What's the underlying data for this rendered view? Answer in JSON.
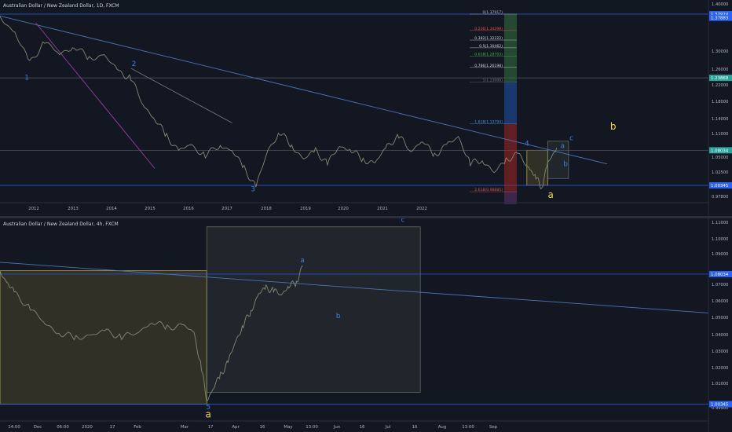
{
  "colors": {
    "background": "#131722",
    "price": "#7f8a72",
    "trendline": "#4a74b8",
    "trend_grey": "#6c7380",
    "trend_purple": "#a03aa8",
    "wave_blue": "#3d7fdc",
    "wave_yellow": "#f5d94a",
    "price_label_blue": "#2962ff",
    "price_label_green": "#26a69a",
    "fib_red": "#b2281f",
    "fib_green": "#2e6a3c",
    "fib_blue": "#1f4f9c",
    "fib_purple": "#5a2e6e"
  },
  "chart_data": [
    {
      "type": "line",
      "title": "Australian Dollar / New Zealand Dollar, 1D, FXCM",
      "x_ticks": [
        "2012",
        "2013",
        "2014",
        "2015",
        "2016",
        "2017",
        "2018",
        "2019",
        "2020",
        "2021",
        "2022"
      ],
      "x_range": [
        2011.1,
        2023.0
      ],
      "y_ticks": [
        "1.40000",
        "1.30000",
        "1.26000",
        "1.22000",
        "1.18000",
        "1.14000",
        "1.11000",
        "1.05000",
        "1.02500",
        "0.97800"
      ],
      "y_range": [
        0.965,
        1.41
      ],
      "price_labels": [
        {
          "text": "1.37924",
          "price": 1.379,
          "color": "blue"
        },
        {
          "text": "1.37883",
          "price": 1.371,
          "color": "blue"
        },
        {
          "text": "1.23868",
          "price": 1.239,
          "color": "green"
        },
        {
          "text": "1.08034",
          "price": 1.08,
          "color": "green"
        },
        {
          "text": "1.00345",
          "price": 1.003,
          "color": "blue"
        }
      ],
      "series": [
        {
          "x": [
            2011.1,
            2011.35,
            2011.6,
            2011.85,
            2012.1,
            2012.35,
            2012.6,
            2012.85,
            2013.1,
            2013.3,
            2013.5,
            2013.7,
            2013.9,
            2014.1,
            2014.3,
            2014.55,
            2014.8,
            2015.0,
            2015.2,
            2015.4,
            2015.6,
            2015.8,
            2016.0,
            2016.2,
            2016.4,
            2016.6,
            2016.8,
            2017.0,
            2017.2,
            2017.4,
            2017.6,
            2017.8,
            2018.0,
            2018.2,
            2018.4,
            2018.6,
            2018.8,
            2019.0,
            2019.2,
            2019.4,
            2019.6,
            2019.8,
            2020.0,
            2020.1,
            2020.2,
            2020.3,
            2020.45
          ],
          "y": [
            1.37,
            1.34,
            1.27,
            1.32,
            1.29,
            1.31,
            1.28,
            1.29,
            1.25,
            1.24,
            1.18,
            1.15,
            1.11,
            1.08,
            1.09,
            1.07,
            1.09,
            1.08,
            1.04,
            1.0,
            1.08,
            1.12,
            1.09,
            1.06,
            1.08,
            1.05,
            1.09,
            1.08,
            1.06,
            1.05,
            1.09,
            1.11,
            1.08,
            1.1,
            1.07,
            1.09,
            1.11,
            1.05,
            1.06,
            1.03,
            1.06,
            1.07,
            1.04,
            1.02,
            1.0,
            1.05,
            1.085
          ]
        }
      ],
      "trendlines": [
        {
          "from": [
            2011.1,
            1.375
          ],
          "to": [
            2021.3,
            1.05
          ],
          "color": "trendline"
        },
        {
          "from": [
            2013.3,
            1.26
          ],
          "to": [
            2015.0,
            1.14
          ],
          "color": "trend_grey"
        },
        {
          "from": [
            2011.7,
            1.36
          ],
          "to": [
            2013.7,
            1.04
          ],
          "color": "trend_purple"
        }
      ],
      "horizontal_levels": [
        1.379,
        1.239,
        1.08,
        1.003
      ],
      "boxes": [
        {
          "x": [
            2019.95,
            2020.3
          ],
          "y": [
            1.003,
            1.08
          ],
          "color": "wave_yellow"
        },
        {
          "x": [
            2020.3,
            2020.65
          ],
          "y": [
            1.018,
            1.1
          ],
          "color": "price"
        }
      ],
      "fib_levels": [
        {
          "label": "0(1.37917)",
          "price": 1.379,
          "color": "#b2b5be"
        },
        {
          "label": "0.236(1.34298)",
          "price": 1.343,
          "color": "#e05252"
        },
        {
          "label": "0.382(1.32222)",
          "price": 1.322,
          "color": "#d1d4dc"
        },
        {
          "label": "0.5(1.30462)",
          "price": 1.305,
          "color": "#d1d4dc"
        },
        {
          "label": "0.618(1.28703)",
          "price": 1.287,
          "color": "#4caf50"
        },
        {
          "label": "0.786(1.26198)",
          "price": 1.262,
          "color": "#d1d4dc"
        },
        {
          "label": "1(1.23000)",
          "price": 1.23,
          "color": "#6c7380"
        },
        {
          "label": "1.618(1.13794)",
          "price": 1.138,
          "color": "#4a90e2"
        },
        {
          "label": "2.618(0.98885)",
          "price": 0.989,
          "color": "#e05252"
        }
      ],
      "wave_labels": [
        {
          "text": "1",
          "x": 2011.55,
          "y": 1.235,
          "color": "wave_blue"
        },
        {
          "text": "2",
          "x": 2013.35,
          "y": 1.265,
          "color": "wave_blue"
        },
        {
          "text": "3",
          "x": 2015.35,
          "y": 0.99,
          "color": "wave_blue"
        },
        {
          "text": "4",
          "x": 2019.95,
          "y": 1.09,
          "color": "wave_blue"
        },
        {
          "text": "a",
          "x": 2020.55,
          "y": 1.085,
          "color": "wave_blue"
        },
        {
          "text": "b",
          "x": 2020.6,
          "y": 1.045,
          "color": "wave_blue"
        },
        {
          "text": "c",
          "x": 2020.7,
          "y": 1.102,
          "color": "wave_blue"
        },
        {
          "text": "b",
          "x": 2021.4,
          "y": 1.125,
          "color": "wave_yellow"
        },
        {
          "text": "a",
          "x": 2020.35,
          "y": 0.975,
          "color": "wave_yellow"
        }
      ]
    },
    {
      "type": "line",
      "title": "Australian Dollar / New Zealand Dollar, 4h, FXCM",
      "x_ticks": [
        "14:00",
        "Dec",
        "06:00",
        "2020",
        "17",
        "Feb",
        "Mar",
        "17",
        "Apr",
        "16",
        "May",
        "13:00",
        "Jun",
        "16",
        "Jul",
        "16",
        "Aug",
        "13:00",
        "Sep"
      ],
      "x_range": [
        0,
        932
      ],
      "y_ticks": [
        "1.11000",
        "1.10000",
        "1.09000",
        "1.07000",
        "1.06000",
        "1.05000",
        "1.04000",
        "1.03000",
        "1.02000",
        "1.01000",
        "0.99900"
      ],
      "y_range": [
        0.993,
        1.113
      ],
      "price_labels": [
        {
          "text": "1.08034",
          "price": 1.08,
          "color": "blue"
        },
        {
          "text": "1.00345",
          "price": 1.003,
          "color": "blue"
        }
      ],
      "series": [
        {
          "x": [
            0,
            10,
            20,
            40,
            60,
            80,
            100,
            120,
            140,
            160,
            180,
            200,
            220,
            240,
            255,
            265,
            272,
            280,
            290,
            300,
            310,
            320,
            330,
            340,
            350,
            360,
            370,
            380,
            390,
            398
          ],
          "y": [
            1.081,
            1.075,
            1.068,
            1.06,
            1.05,
            1.045,
            1.042,
            1.044,
            1.046,
            1.043,
            1.045,
            1.052,
            1.048,
            1.05,
            1.045,
            1.025,
            1.005,
            1.012,
            1.02,
            1.028,
            1.04,
            1.05,
            1.058,
            1.068,
            1.072,
            1.07,
            1.068,
            1.073,
            1.075,
            1.085
          ]
        }
      ],
      "trendlines": [
        {
          "from": [
            0,
            1.087
          ],
          "to": [
            932,
            1.057
          ],
          "color": "trendline"
        }
      ],
      "horizontal_levels": [
        1.08,
        1.003
      ],
      "boxes": [
        {
          "x": [
            0,
            272
          ],
          "y": [
            1.003,
            1.082
          ],
          "color": "wave_yellow"
        },
        {
          "x": [
            272,
            553
          ],
          "y": [
            1.01,
            1.108
          ],
          "color": "price"
        }
      ],
      "wave_labels": [
        {
          "text": "a",
          "x": 398,
          "y": 1.087,
          "color": "wave_blue"
        },
        {
          "text": "b",
          "x": 445,
          "y": 1.054,
          "color": "wave_blue"
        },
        {
          "text": "c",
          "x": 530,
          "y": 1.111,
          "color": "wave_blue"
        },
        {
          "text": "5",
          "x": 274,
          "y": 1.0,
          "color": "wave_blue"
        },
        {
          "text": "a",
          "x": 274,
          "y": 0.995,
          "color": "wave_yellow"
        }
      ]
    }
  ]
}
